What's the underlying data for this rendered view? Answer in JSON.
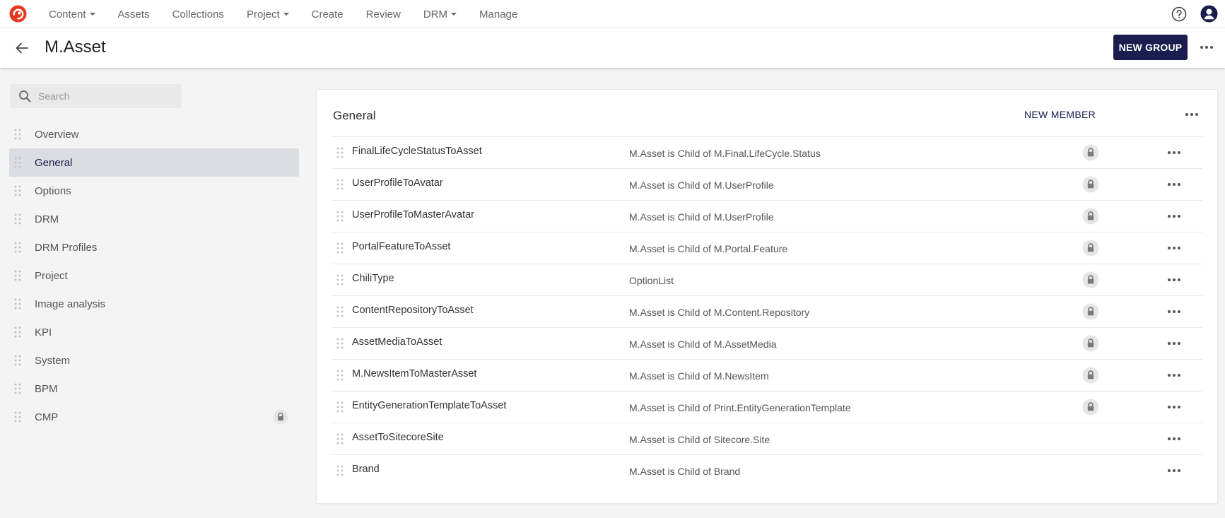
{
  "colors": {
    "brand_red": "#e8371e",
    "primary_button": "#1a1d4e",
    "active_item_bg": "#dcdde2"
  },
  "topnav": {
    "logo": "sitecore-logo",
    "items": [
      {
        "label": "Content",
        "dropdown": true
      },
      {
        "label": "Assets",
        "dropdown": false
      },
      {
        "label": "Collections",
        "dropdown": false
      },
      {
        "label": "Project",
        "dropdown": true
      },
      {
        "label": "Create",
        "dropdown": false
      },
      {
        "label": "Review",
        "dropdown": false
      },
      {
        "label": "DRM",
        "dropdown": true
      },
      {
        "label": "Manage",
        "dropdown": false
      }
    ],
    "icons": [
      "help-icon",
      "user-avatar-icon"
    ]
  },
  "header": {
    "title": "M.Asset",
    "new_group_label": "NEW GROUP"
  },
  "sidebar": {
    "search_placeholder": "Search",
    "items": [
      {
        "label": "Overview",
        "active": false,
        "locked": false
      },
      {
        "label": "General",
        "active": true,
        "locked": false
      },
      {
        "label": "Options",
        "active": false,
        "locked": false
      },
      {
        "label": "DRM",
        "active": false,
        "locked": false
      },
      {
        "label": "DRM Profiles",
        "active": false,
        "locked": false
      },
      {
        "label": "Project",
        "active": false,
        "locked": false
      },
      {
        "label": "Image analysis",
        "active": false,
        "locked": false
      },
      {
        "label": "KPI",
        "active": false,
        "locked": false
      },
      {
        "label": "System",
        "active": false,
        "locked": false
      },
      {
        "label": "BPM",
        "active": false,
        "locked": false
      },
      {
        "label": "CMP",
        "active": false,
        "locked": true
      }
    ]
  },
  "main": {
    "group_title": "General",
    "new_member_label": "NEW MEMBER",
    "members": [
      {
        "name": "FinalLifeCycleStatusToAsset",
        "description": "M.Asset is Child of M.Final.LifeCycle.Status",
        "locked": true
      },
      {
        "name": "UserProfileToAvatar",
        "description": "M.Asset is Child of M.UserProfile",
        "locked": true
      },
      {
        "name": "UserProfileToMasterAvatar",
        "description": "M.Asset is Child of M.UserProfile",
        "locked": true
      },
      {
        "name": "PortalFeatureToAsset",
        "description": "M.Asset is Child of M.Portal.Feature",
        "locked": true
      },
      {
        "name": "ChiliType",
        "description": "OptionList",
        "locked": true
      },
      {
        "name": "ContentRepositoryToAsset",
        "description": "M.Asset is Child of M.Content.Repository",
        "locked": true
      },
      {
        "name": "AssetMediaToAsset",
        "description": "M.Asset is Child of M.AssetMedia",
        "locked": true
      },
      {
        "name": "M.NewsItemToMasterAsset",
        "description": "M.Asset is Child of M.NewsItem",
        "locked": true
      },
      {
        "name": "EntityGenerationTemplateToAsset",
        "description": "M.Asset is Child of Print.EntityGenerationTemplate",
        "locked": true
      },
      {
        "name": "AssetToSitecoreSite",
        "description": "M.Asset is Child of Sitecore.Site",
        "locked": false
      },
      {
        "name": "Brand",
        "description": "M.Asset is Child of Brand",
        "locked": false
      }
    ]
  }
}
